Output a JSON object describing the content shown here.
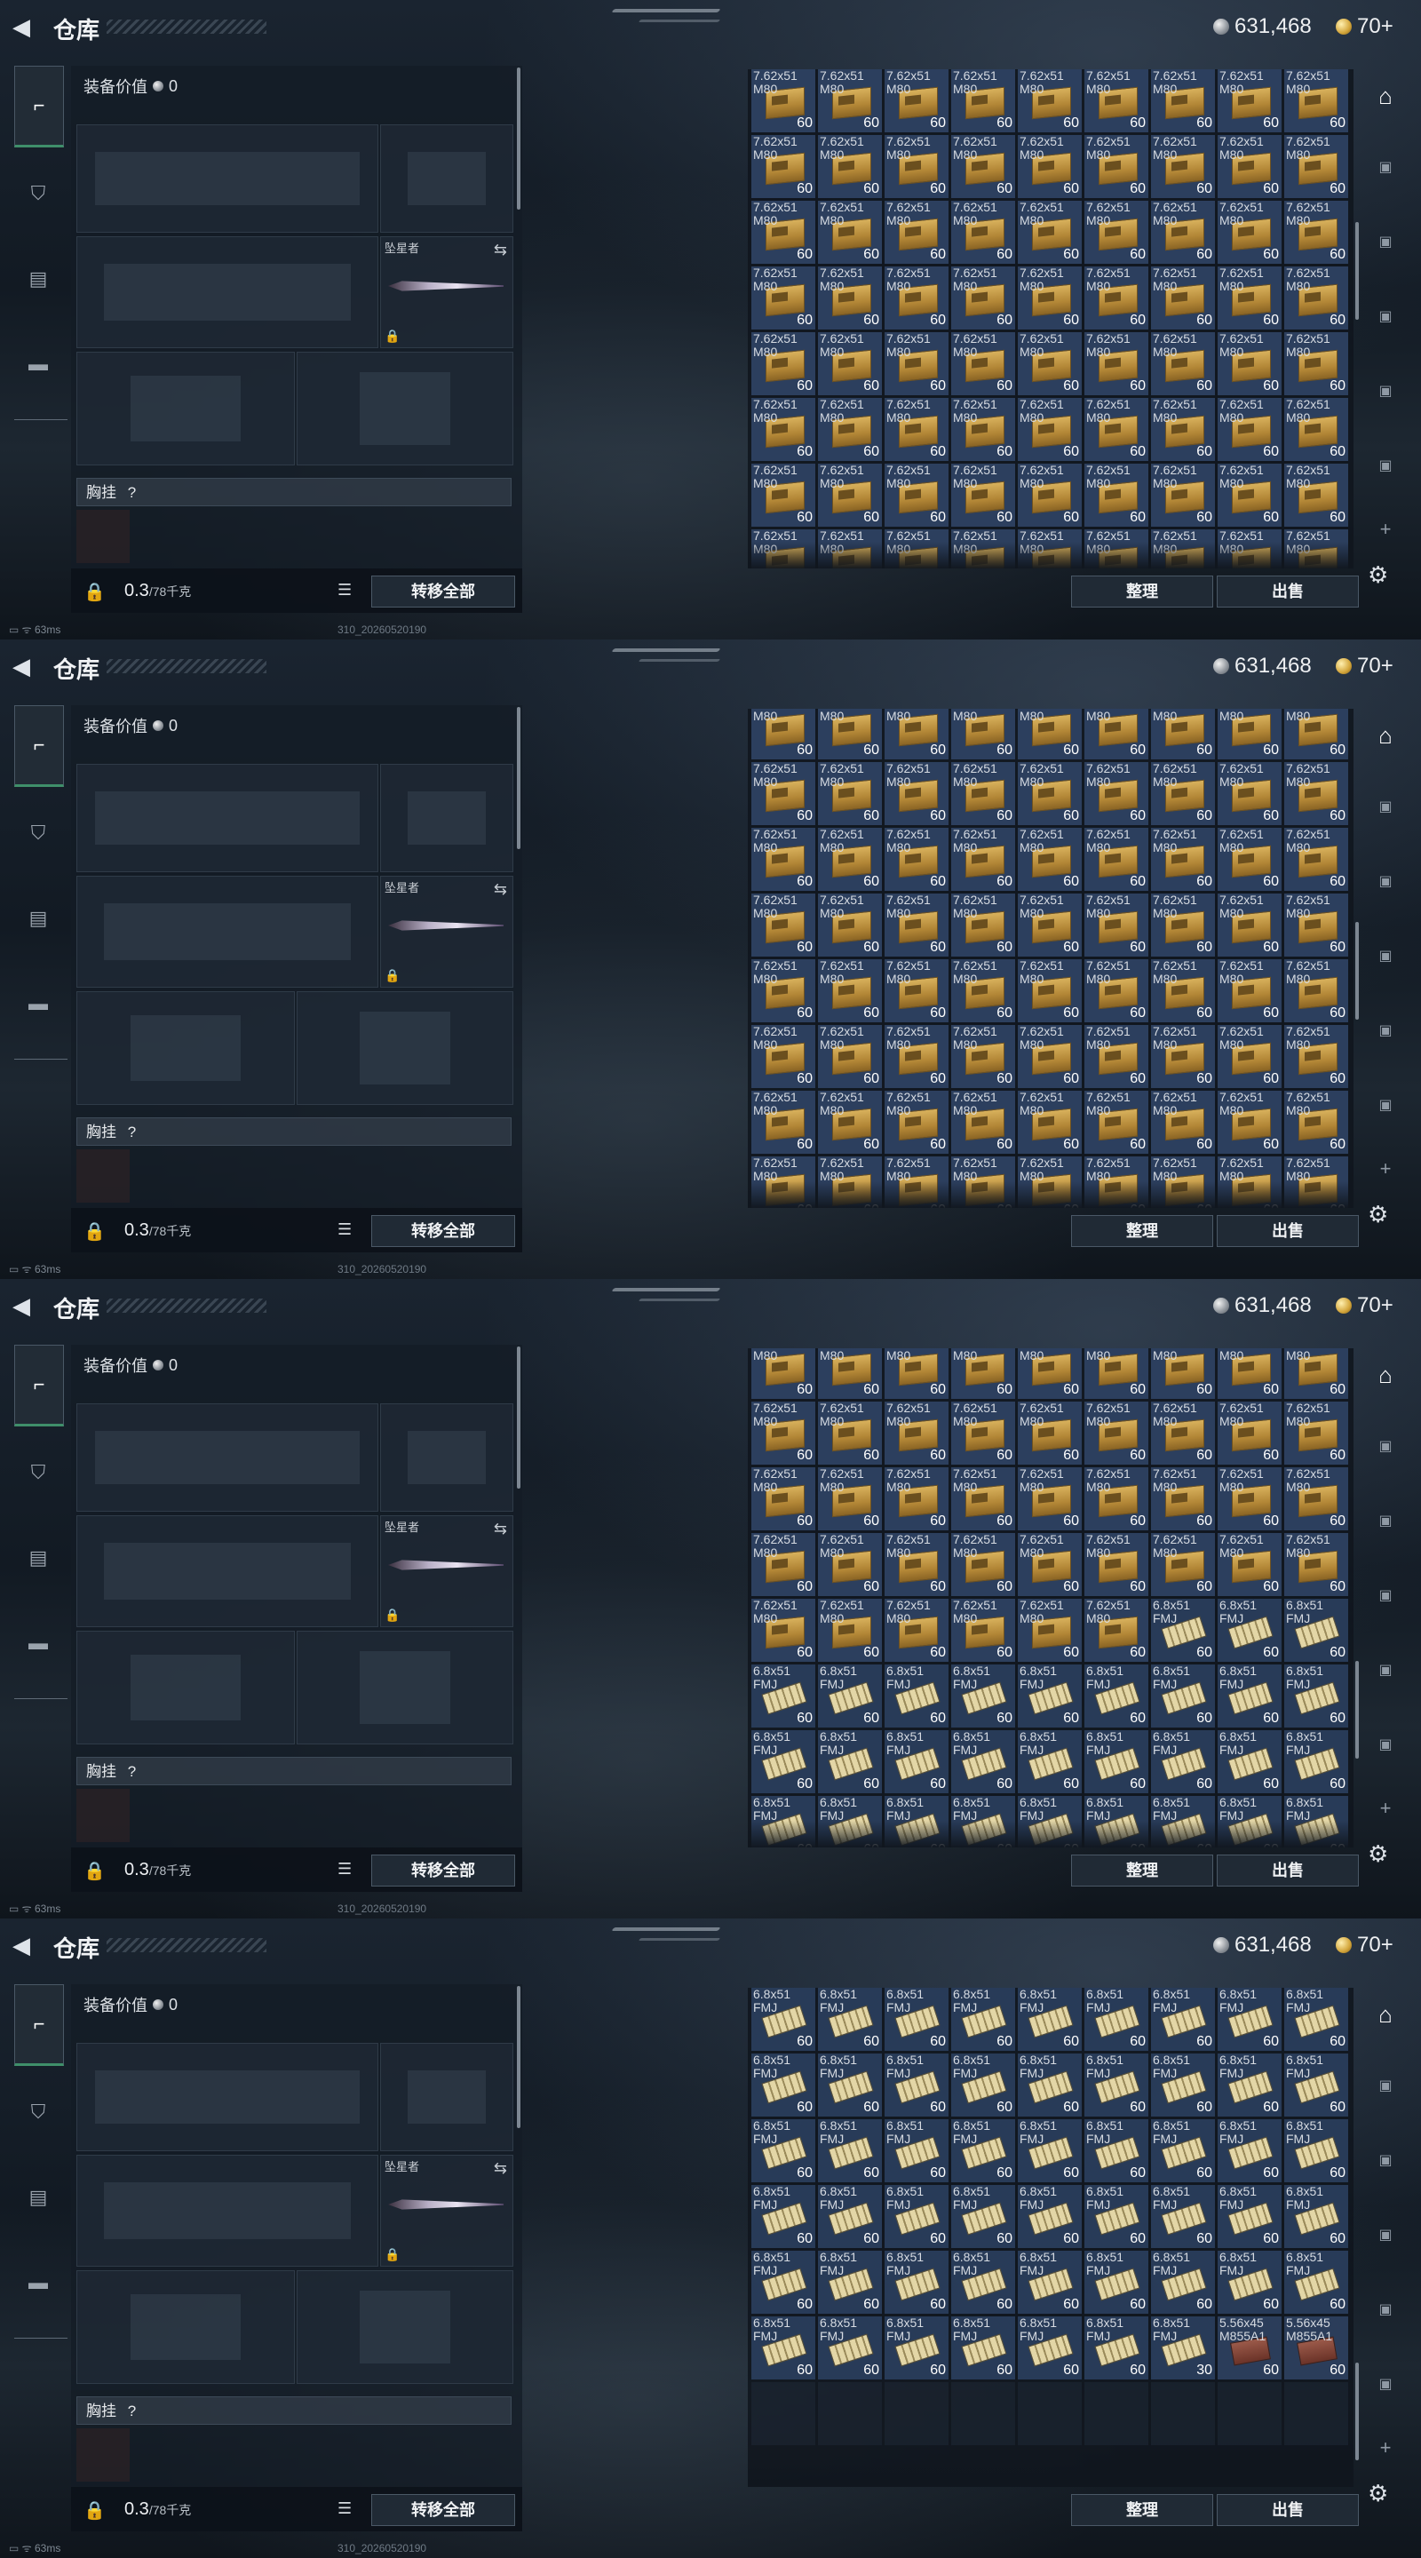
{
  "frames": [
    {
      "scroll": "top"
    },
    {
      "scroll": "upper-middle"
    },
    {
      "scroll": "lower-middle"
    },
    {
      "scroll": "bottom"
    }
  ],
  "header": {
    "title": "仓库",
    "silver": "631,468",
    "gold": "70+"
  },
  "equipment": {
    "value_label": "装备价值",
    "value": "0",
    "melee_label": "坠星者",
    "chest_label": "胸挂",
    "chest_help": "?",
    "weight": "0.3",
    "weight_max": "/78千克",
    "transfer_all": "转移全部"
  },
  "inventory": {
    "sort": "整理",
    "sell": "出售",
    "item_types": {
      "box762": {
        "name": "7.62x51\nM80",
        "qty": "60",
        "icon": "ammo-box-icon"
      },
      "shell68": {
        "name": "6.8x51\nFMJ",
        "qty": "60",
        "icon": "ammo-shells-icon"
      },
      "shell68_30": {
        "name": "6.8x51\nFMJ",
        "qty": "30",
        "icon": "ammo-shells-icon"
      },
      "ammo556": {
        "name": "5.56x45\nM855A1",
        "qty": "60",
        "icon": "ammo-box-red-icon"
      }
    }
  },
  "status": {
    "ping": "63ms",
    "build": "310_20260520190"
  },
  "colors": {
    "accent": "#3f8f6a",
    "gold": "#d3a53a",
    "panel": "#202a35"
  }
}
